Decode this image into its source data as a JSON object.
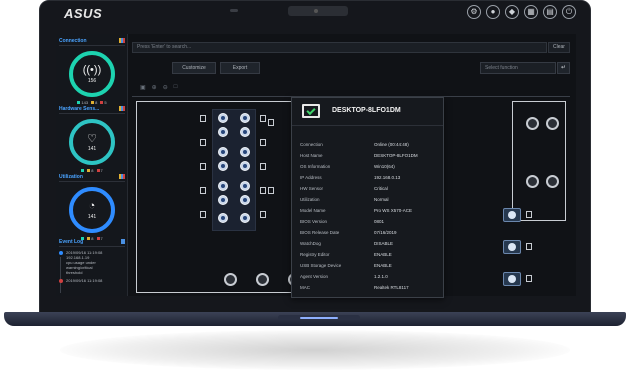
{
  "laptop": {
    "brand": "ASUS",
    "top_icons": [
      "settings-icon",
      "user-icon",
      "shield-icon",
      "calendar-icon",
      "chart-icon",
      "power-icon"
    ]
  },
  "sidebar": {
    "connection": {
      "title": "Connection",
      "value": "156",
      "legend": [
        "143",
        "8",
        "5"
      ]
    },
    "hardware": {
      "title": "Hardware Sens...",
      "value": "141",
      "legend": [
        "8",
        "7"
      ]
    },
    "utilization": {
      "title": "Utilization",
      "value": "141",
      "legend": [
        "8",
        "7"
      ]
    },
    "event_log": {
      "title": "Event Log",
      "entries": [
        {
          "time": "2019/09/16 11:19:08",
          "text": "192.168.1.19"
        },
        {
          "time": "",
          "text": "cpu usage under"
        },
        {
          "time": "",
          "text": "warning/critical"
        },
        {
          "time": "",
          "text": "threshold"
        },
        {
          "time": "2019/09/16 11:19:08",
          "text": ""
        }
      ]
    },
    "colors": {
      "green": "#1dd3b0",
      "blue": "#2f8cff",
      "yellow": "#e0b030",
      "red": "#d04040"
    }
  },
  "toolbar": {
    "search_placeholder": "Press 'Enter' to search...",
    "clear_label": "Clear",
    "customize_label": "Customize",
    "export_label": "Export",
    "select_placeholder": "Select function",
    "enter_icon": "↵"
  },
  "popup": {
    "title": "DESKTOP-8LFO1DM",
    "rows": [
      {
        "k": "Connection",
        "v": "Online (00:44:48)"
      },
      {
        "k": "Host Name",
        "v": "DESKTOP-8LFO1DM"
      },
      {
        "k": "OS Information",
        "v": "Win10(64)"
      },
      {
        "k": "IP Address",
        "v": "192.168.0.13"
      },
      {
        "k": "HW Sensor",
        "v": "Critical"
      },
      {
        "k": "Utilization",
        "v": "Normal"
      },
      {
        "k": "Model Name",
        "v": "Pro WS X570-ACE"
      },
      {
        "k": "BIOS Version",
        "v": "0801"
      },
      {
        "k": "BIOS Release Date",
        "v": "07/16/2019"
      },
      {
        "k": "WatchDog",
        "v": "DISABLE"
      },
      {
        "k": "Registry Editor",
        "v": "ENABLE"
      },
      {
        "k": "USB Storage Device",
        "v": "ENABLE"
      },
      {
        "k": "Agent Version",
        "v": "1.2.1.0"
      },
      {
        "k": "MAC",
        "v": "Realtek RTL8117"
      }
    ]
  }
}
